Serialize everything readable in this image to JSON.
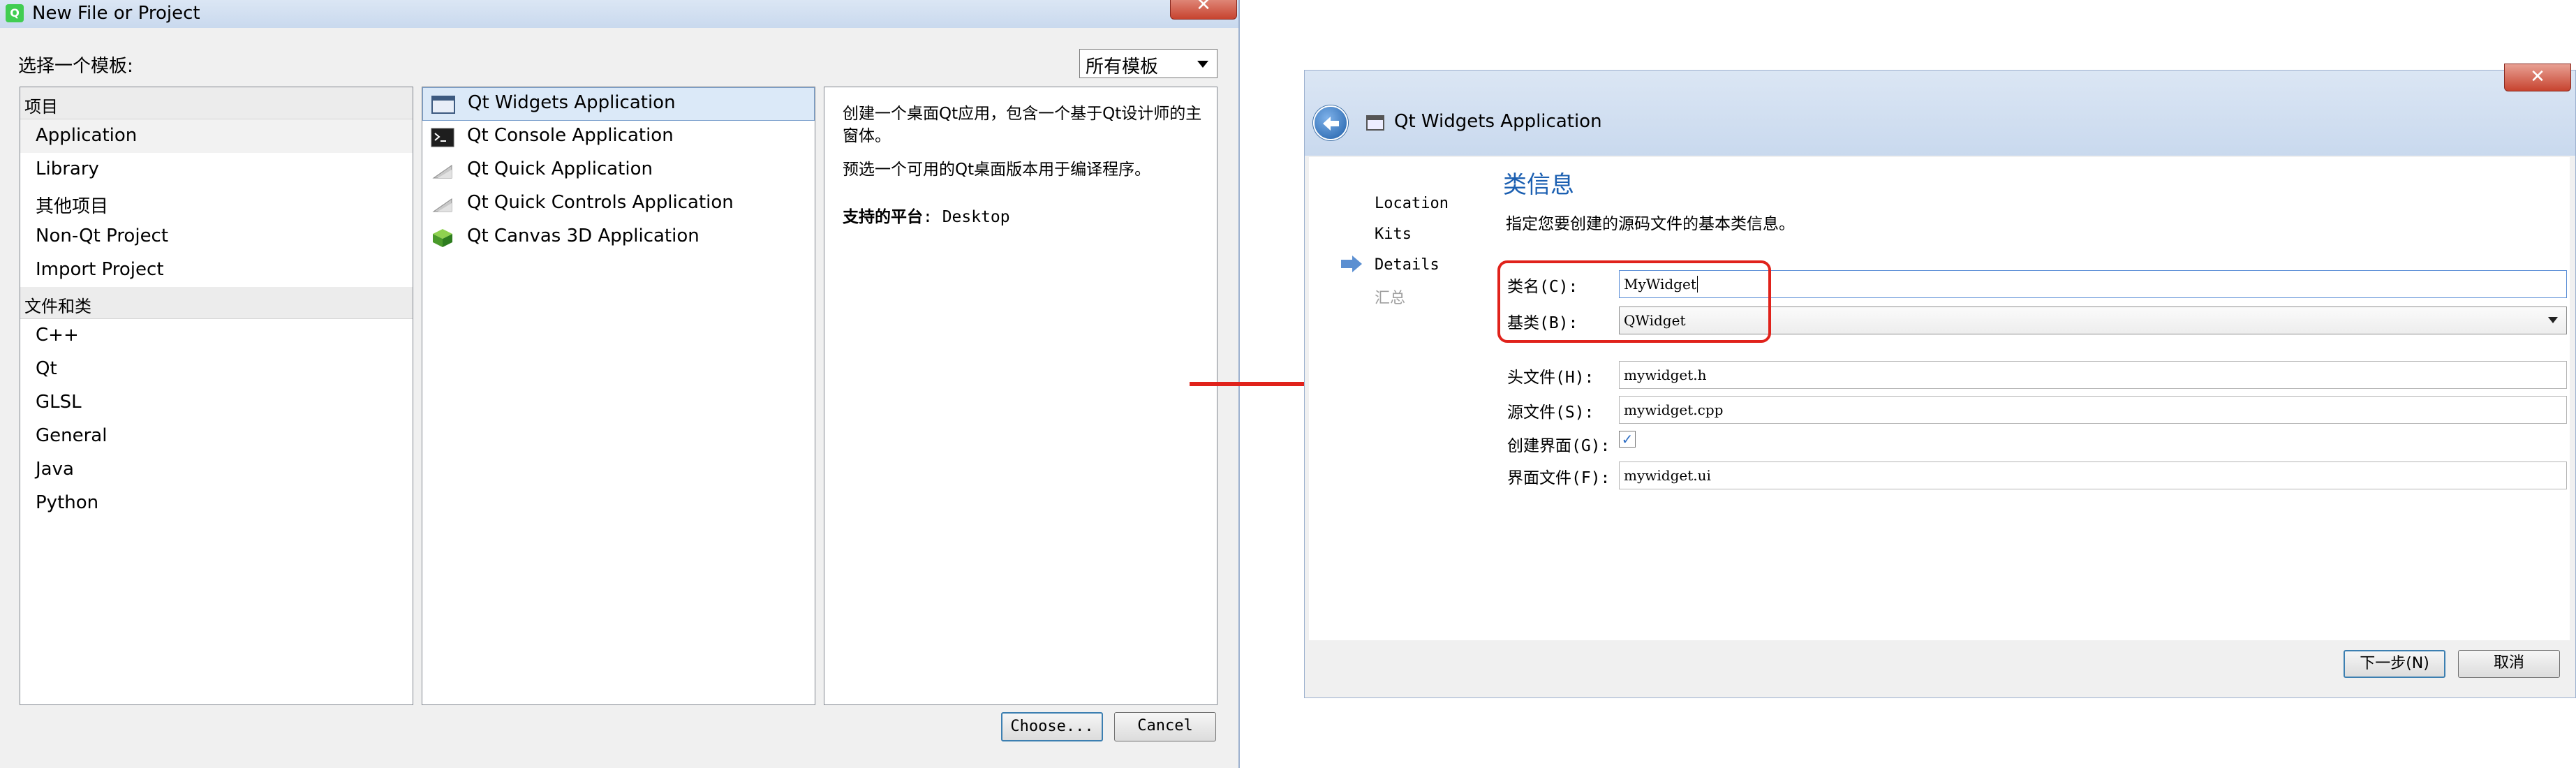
{
  "dialog1": {
    "title": "New File or Project",
    "close_glyph": "✕",
    "choose_template_label": "选择一个模板:",
    "filter": {
      "value": "所有模板"
    },
    "categories": {
      "group1_header": "项目",
      "group1_items": [
        "Application",
        "Library",
        "其他项目",
        "Non-Qt Project",
        "Import Project"
      ],
      "group2_header": "文件和类",
      "group2_items": [
        "C++",
        "Qt",
        "GLSL",
        "General",
        "Java",
        "Python"
      ],
      "selected": "Application"
    },
    "templates": [
      {
        "label": "Qt Widgets Application",
        "icon": "widgets-window-icon"
      },
      {
        "label": "Qt Console Application",
        "icon": "console-icon"
      },
      {
        "label": "Qt Quick Application",
        "icon": "quick-icon"
      },
      {
        "label": "Qt Quick Controls Application",
        "icon": "quick-controls-icon"
      },
      {
        "label": "Qt Canvas 3D Application",
        "icon": "cube-icon"
      }
    ],
    "description": {
      "line1": "创建一个桌面Qt应用，包含一个基于Qt设计师的主窗体。",
      "line2": "预选一个可用的Qt桌面版本用于编译程序。",
      "platform_label": "支持的平台",
      "platform_value": ": Desktop"
    },
    "buttons": {
      "choose": "Choose...",
      "cancel": "Cancel"
    }
  },
  "dialog2": {
    "title": "Qt Widgets Application",
    "close_glyph": "✕",
    "steps": [
      "Location",
      "Kits",
      "Details",
      "汇总"
    ],
    "current_step": "Details",
    "section_title": "类信息",
    "section_description": "指定您要创建的源码文件的基本类信息。",
    "fields": {
      "class_name_label": "类名",
      "class_name_shortcut": "(C):",
      "class_name_value": "MyWidget",
      "base_class_label": "基类",
      "base_class_shortcut": "(B):",
      "base_class_value": "QWidget",
      "header_label": "头文件",
      "header_shortcut": "(H):",
      "header_value": "mywidget.h",
      "source_label": "源文件",
      "source_shortcut": "(S):",
      "source_value": "mywidget.cpp",
      "generate_form_label": "创建界面",
      "generate_form_shortcut": "(G):",
      "generate_form_checked": true,
      "form_label": "界面文件",
      "form_shortcut": "(F):",
      "form_value": "mywidget.ui"
    },
    "buttons": {
      "next": "下一步(N)",
      "cancel": "取消"
    }
  },
  "colors": {
    "highlight_box": "#e0221b",
    "arrow": "#e0221b",
    "section_title": "#1b5fb1",
    "selection": "#dbe9f8"
  }
}
